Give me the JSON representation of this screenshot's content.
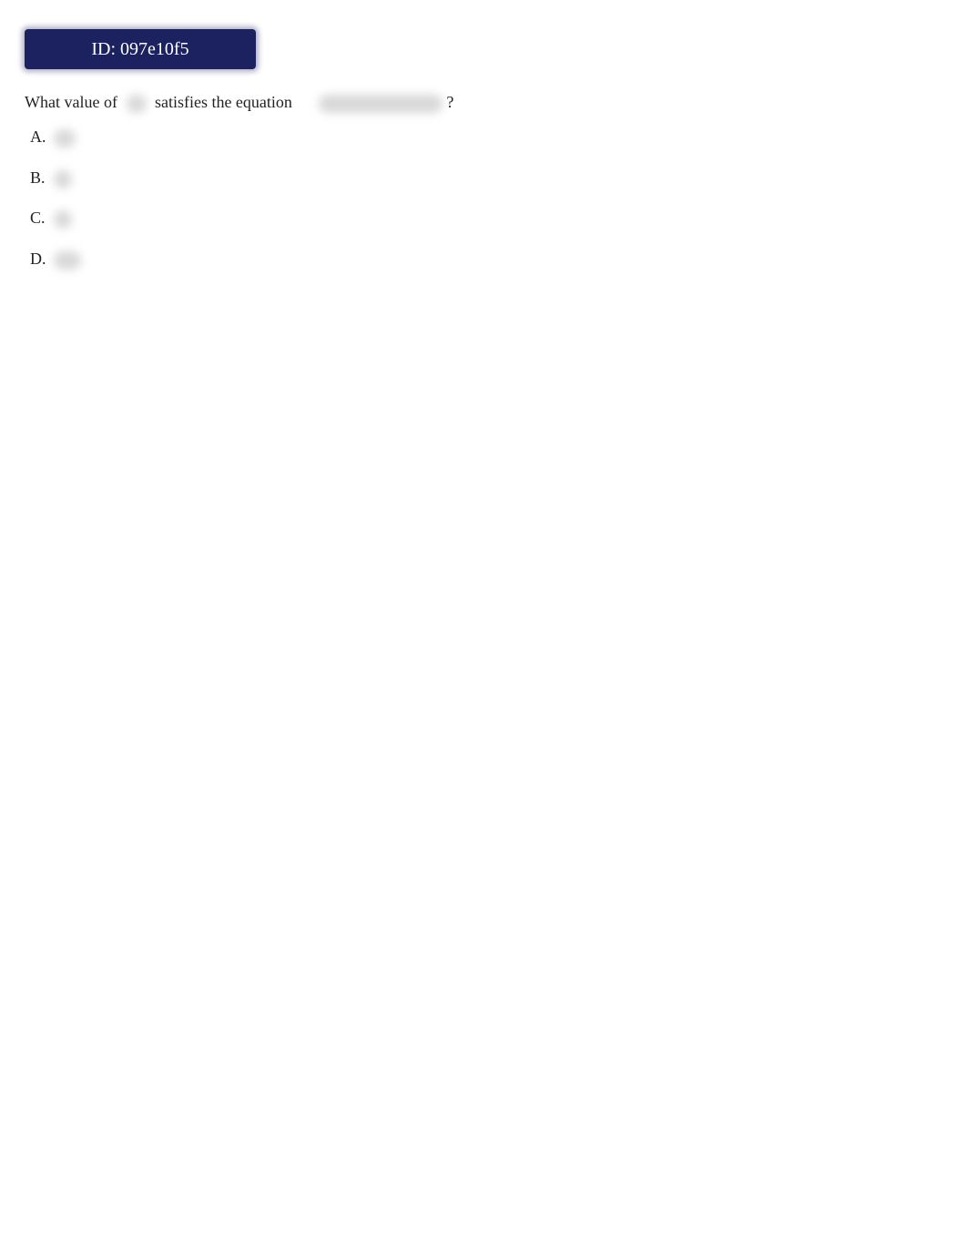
{
  "header": {
    "id_label": "ID: 097e10f5",
    "badge_color": "#1c2260"
  },
  "question": {
    "text_before": "What value of",
    "variable": "",
    "text_middle": "satisfies the equation",
    "equation": "",
    "text_after": "?"
  },
  "options": [
    {
      "letter": "A.",
      "value": ""
    },
    {
      "letter": "B.",
      "value": ""
    },
    {
      "letter": "C.",
      "value": ""
    },
    {
      "letter": "D.",
      "value": ""
    }
  ]
}
